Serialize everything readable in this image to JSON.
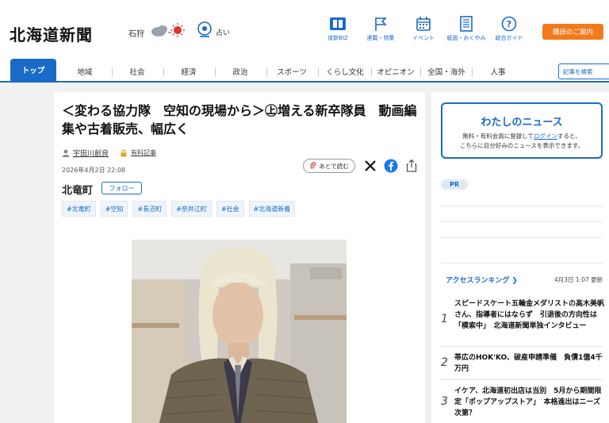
{
  "header": {
    "logo": "北海道新聞",
    "city": "石狩",
    "fortune_label": "占い",
    "nav": [
      {
        "label": "道新BIZ"
      },
      {
        "label": "連載・特集"
      },
      {
        "label": "イベント"
      },
      {
        "label": "紙面・おくやみ"
      },
      {
        "label": "総合ガイド"
      }
    ],
    "subscribe_label": "購読のご案内"
  },
  "mainnav": {
    "items": [
      "トップ",
      "地域",
      "社会",
      "経済",
      "政治",
      "スポーツ",
      "くらし文化",
      "オピニオン",
      "全国・海外",
      "人事"
    ],
    "search_label": "記事を検索"
  },
  "article": {
    "title": "＜変わる協力隊　空知の現場から＞㊤増える新卒隊員　動画編集や古着販売、幅広く",
    "author": "宇田川創良",
    "paid_label": "有料記事",
    "date": "2026年4月2日 22:08",
    "read_later": "あとで読む",
    "place": "北竜町",
    "follow_label": "フォロー",
    "tags": [
      "#北竜町",
      "#空知",
      "#長沼町",
      "#奈井江町",
      "#社会",
      "#北海道新着"
    ]
  },
  "sidebar": {
    "mynews_title": "わたしのニュース",
    "mynews_desc_1": "無料・有料会員に登録して",
    "mynews_login": "ログイン",
    "mynews_desc_2": "すると、",
    "mynews_desc_3": "こちらに自分好みのニュースを表示できます。",
    "pr_label": "PR",
    "ranking_title": "アクセスランキング",
    "ranking_time": "4月3日 1:07 更新",
    "ranking": [
      {
        "num": "1",
        "text": "スピードスケート五輪金メダリストの高木美帆さん、指導者にはならず　引退後の方向性は「模索中」　北海道新聞単独インタビュー"
      },
      {
        "num": "2",
        "text": "帯広のHOK'KO、破産申請準備　負債1億4千万円"
      },
      {
        "num": "3",
        "text": "イケア、北海道初出店は当別　5月から期間限定「ポップアップストア」　本格進出はニーズ次第？"
      }
    ]
  }
}
